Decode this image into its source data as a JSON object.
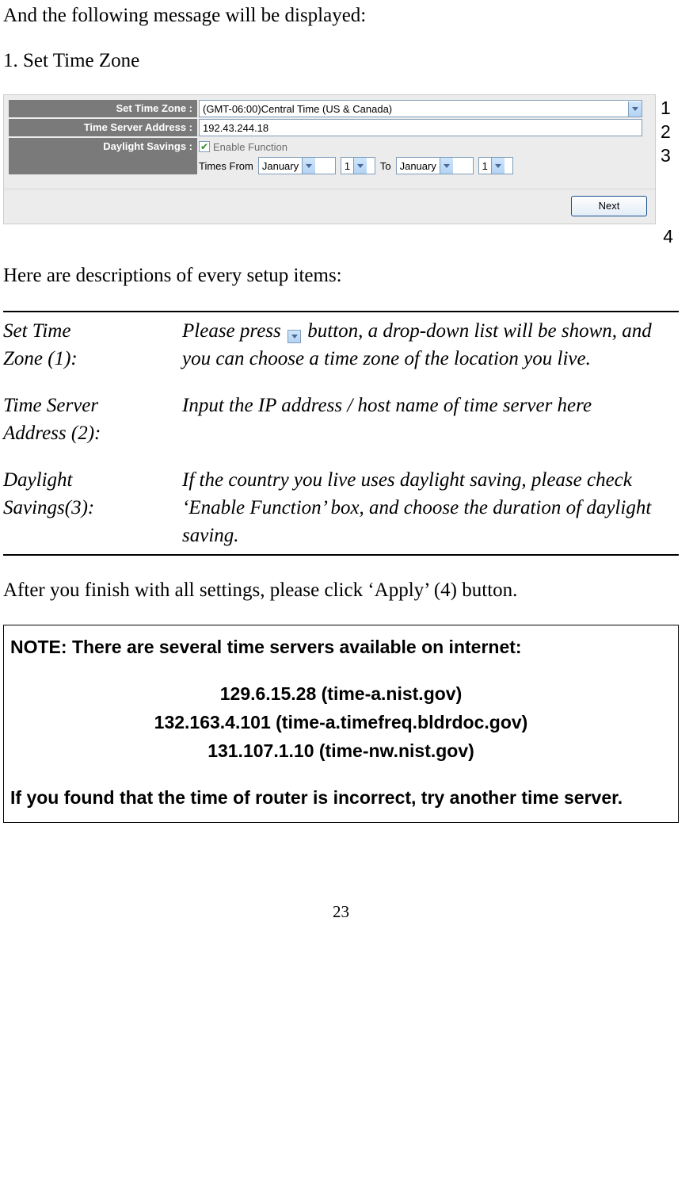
{
  "intro_text": "And the following message will be displayed:",
  "section_heading": "1. Set Time Zone",
  "form": {
    "row1_label": "Set Time Zone :",
    "row1_value": "(GMT-06:00)Central Time (US & Canada)",
    "row2_label": "Time Server Address :",
    "row2_value": "192.43.244.18",
    "row3_label": "Daylight Savings :",
    "row3_checkbox_label": "Enable Function",
    "row3_checkbox_checked": true,
    "row3_times_from": "Times From",
    "row3_from_month": "January",
    "row3_from_day": "1",
    "row3_to": "To",
    "row3_to_month": "January",
    "row3_to_day": "1",
    "next_button": "Next"
  },
  "annotations": {
    "a1": "1",
    "a2": "2",
    "a3": "3",
    "a4": "4"
  },
  "desc_intro": "Here are descriptions of every setup items:",
  "desc": {
    "r1_label_l1": "Set Time",
    "r1_label_l2": "Zone (1):",
    "r1_text_pre": "Please press ",
    "r1_text_post": " button, a drop-down list will be shown, and you can choose a time zone of the location you live.",
    "r2_label_l1": "Time Server",
    "r2_label_l2": "Address (2):",
    "r2_text": "Input the IP address / host name of time server here",
    "r3_label_l1": "Daylight",
    "r3_label_l2": "Savings(3):",
    "r3_text": "If the country you live uses daylight saving, please check ‘Enable Function’ box, and choose the duration of daylight saving."
  },
  "after_text": "After you finish with all settings, please click ‘Apply’ (4) button.",
  "note": {
    "title": "NOTE: There are several time servers available on internet:",
    "servers": [
      "129.6.15.28 (time-a.nist.gov)",
      "132.163.4.101 (time-a.timefreq.bldrdoc.gov)",
      "131.107.1.10 (time-nw.nist.gov)"
    ],
    "footer": "If you found that the time of router is incorrect, try another time server."
  },
  "page_number": "23"
}
